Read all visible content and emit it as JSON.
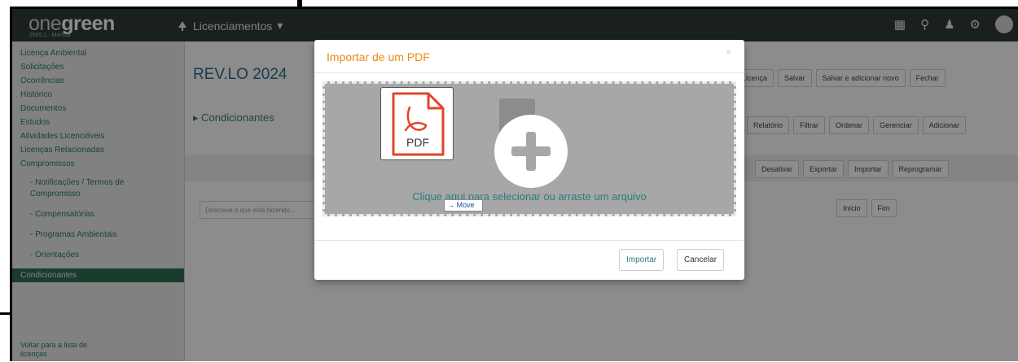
{
  "app": {
    "logo_light": "one",
    "logo_bold": "green",
    "version": "2505.1 - Manual",
    "module": "Licenciamentos"
  },
  "sidebar": {
    "items": [
      "Licença Ambiental",
      "Solicitações",
      "Ocorrências",
      "Histórico",
      "Documentos",
      "Estudos",
      "Atividades Licenciáveis",
      "Licenças Relacionadas",
      "Compromissos"
    ],
    "sub_items": [
      "- Notificações / Termos de Compromisso",
      "- Compensatórias",
      "- Programas Ambientais",
      "- Orientações"
    ],
    "active": "Condicionantes",
    "footer": "Voltar para a lista de licenças"
  },
  "page": {
    "title": "REV.LO 2024",
    "section": "Condicionantes",
    "toolbar": [
      "Licença",
      "Salvar",
      "Salvar e adicionar novo",
      "Fechar"
    ],
    "filters": [
      "Relatório",
      "Filtrar",
      "Ordenar",
      "Gerenciar",
      "Adicionar"
    ],
    "actions": [
      "Desativar",
      "Exportar",
      "Importar",
      "Reprogramar"
    ],
    "search_placeholder": "Descreva o que está fazendo...",
    "date_start": "Início",
    "date_end": "Fim"
  },
  "modal": {
    "title": "Importar de um PDF",
    "close": "×",
    "pdf_label": "PDF",
    "dropzone_text": "Clique aqui para selecionar ou arraste um arquivo",
    "drag_tooltip": "→ Move",
    "import_button": "Importar",
    "cancel_button": "Cancelar"
  },
  "colors": {
    "modal_title": "#e98a16",
    "primary_text": "#2f7b78",
    "pdf_red": "#e0452e",
    "topbar": "#2e3b36"
  }
}
